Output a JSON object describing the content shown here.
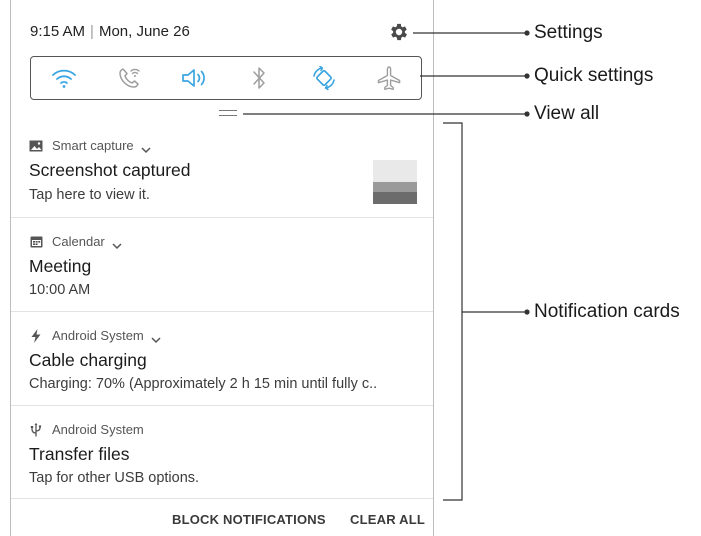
{
  "status_bar": {
    "time": "9:15 AM",
    "date": "Mon, June 26",
    "settings_icon": "gear-icon"
  },
  "quick_settings": {
    "icons": [
      "wifi-icon",
      "wifi-calling-icon",
      "sound-icon",
      "bluetooth-icon",
      "auto-rotate-icon",
      "airplane-mode-icon"
    ],
    "active_color": "#3aa5e0",
    "inactive_color": "#9e9e9e"
  },
  "notifications": [
    {
      "app": "Smart capture",
      "app_icon": "image-icon",
      "has_chevron": true,
      "title": "Screenshot captured",
      "text": "Tap here to view it.",
      "has_thumbnail": true
    },
    {
      "app": "Calendar",
      "app_icon": "calendar-icon",
      "has_chevron": true,
      "title": "Meeting",
      "text": "10:00 AM"
    },
    {
      "app": "Android System",
      "app_icon": "lightning-icon",
      "has_chevron": true,
      "title": "Cable charging",
      "text": "Charging: 70% (Approximately 2 h 15 min until fully c.."
    },
    {
      "app": "Android System",
      "app_icon": "usb-icon",
      "has_chevron": false,
      "title": "Transfer files",
      "text": "Tap for other USB options."
    }
  ],
  "bottom_bar": {
    "block_label": "BLOCK NOTIFICATIONS",
    "clear_label": "CLEAR ALL"
  },
  "callouts": {
    "settings": "Settings",
    "quick_settings": "Quick settings",
    "view_all": "View all",
    "notification_cards": "Notification cards"
  }
}
